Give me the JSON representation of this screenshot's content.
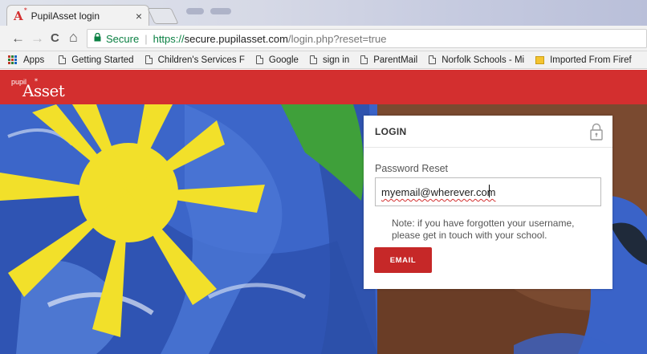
{
  "browser": {
    "tab_title": "PupilAsset login",
    "tab_close": "×",
    "favicon_letter": "A",
    "favicon_sup": "*",
    "nav": {
      "back": "←",
      "forward": "→",
      "reload": "C",
      "home": "⌂"
    },
    "omnibox": {
      "security_label": "Secure",
      "url_scheme": "https://",
      "url_host": "secure.pupilasset.com",
      "url_path": "/login.php?reset=true"
    },
    "bookmarks": [
      {
        "label": "Apps",
        "icon": "apps-grid-icon"
      },
      {
        "label": "Getting Started",
        "icon": "page-icon"
      },
      {
        "label": "Children's Services F",
        "icon": "page-icon"
      },
      {
        "label": "Google",
        "icon": "page-icon"
      },
      {
        "label": "sign in",
        "icon": "page-icon"
      },
      {
        "label": "ParentMail",
        "icon": "page-icon"
      },
      {
        "label": "Norfolk Schools - Mi",
        "icon": "page-icon"
      },
      {
        "label": "Imported From Firef",
        "icon": "folder-icon"
      }
    ]
  },
  "site": {
    "logo_small": "pupil",
    "logo_big": "Asset",
    "logo_star": "*",
    "header_color": "#d32f2f"
  },
  "login": {
    "title": "LOGIN",
    "field_label": "Password Reset",
    "email_value": "myemail@wherever.com",
    "note": "Note: if you have forgotten your username, please get in touch with your school.",
    "button_label": "EMAIL",
    "button_color": "#c62828"
  }
}
